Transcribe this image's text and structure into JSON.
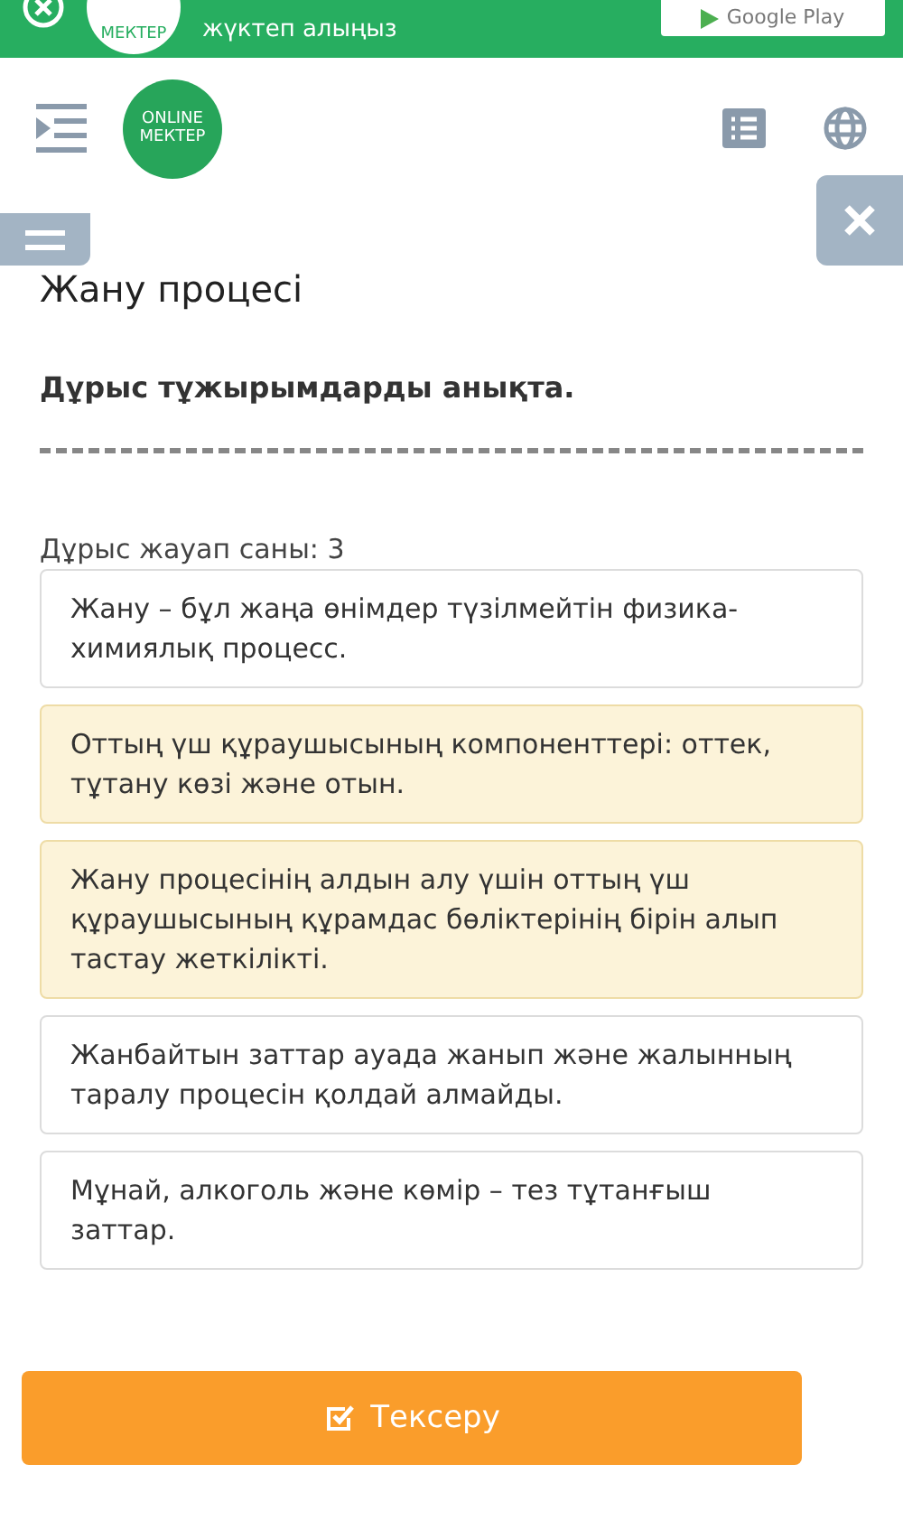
{
  "banner": {
    "logo_text": "МЕКТЕР",
    "message": "жүктеп алыңыз",
    "store_button": "Google Play"
  },
  "header": {
    "logo_line_1": "ONLINE",
    "logo_line_2": "МЕКТЕР"
  },
  "lesson_title": "Жану процесі",
  "question": "Дұрыс тұжырымдарды анықта.",
  "answer_count": "Дұрыс жауап саны: 3",
  "options": [
    {
      "text": "Жану – бұл жаңа өнімдер түзілмейтін физика-химиялық процесс.",
      "selected": false
    },
    {
      "text": "Оттың үш құраушысының компоненттері: оттек, тұтану көзі және отын.",
      "selected": true
    },
    {
      "text": "Жану процесінің алдын алу үшін оттың үш құраушысының құрамдас бөліктерінің бірін алып тастау жеткілікті.",
      "selected": true
    },
    {
      "text": "Жанбайтын заттар ауада жанып және жалынның таралу процесін қолдай алмайды.",
      "selected": false
    },
    {
      "text": "Мұнай, алкоголь және көмір – тез тұтанғыш заттар.",
      "selected": false
    }
  ],
  "check_button": "Тексеру"
}
